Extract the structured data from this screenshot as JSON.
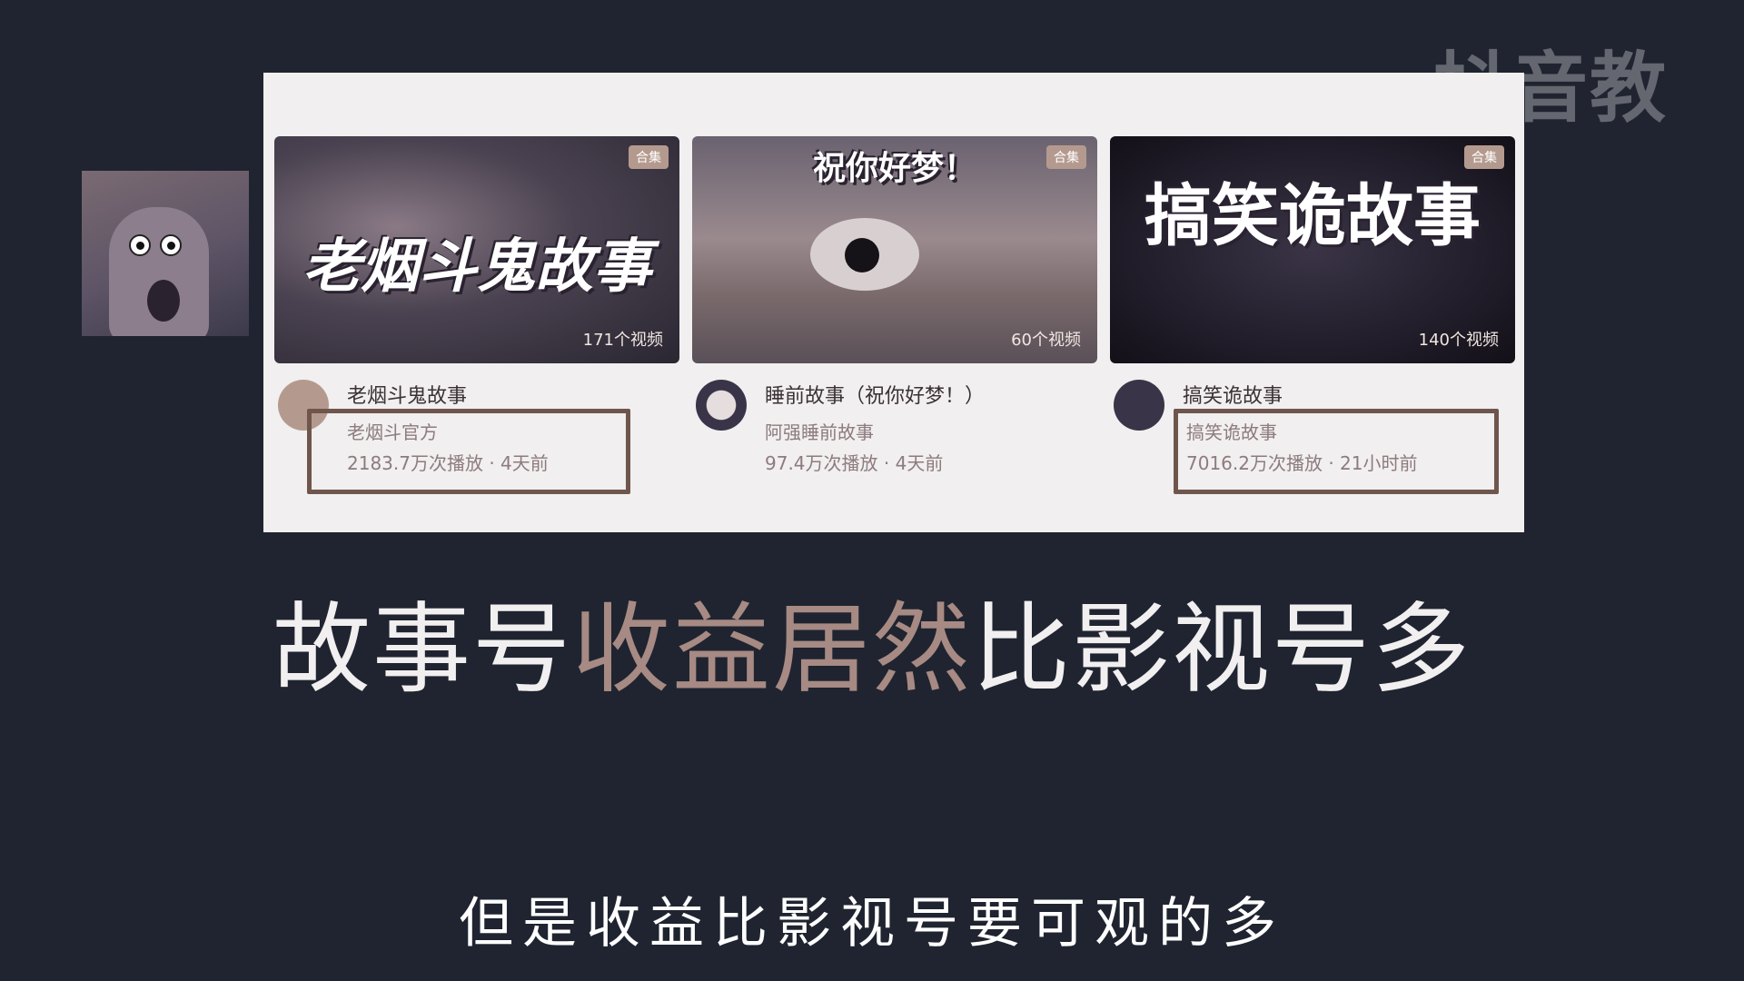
{
  "watermark": "抖音教程",
  "cards": [
    {
      "thumb_title": "老烟斗鬼故事",
      "badge": "合集",
      "video_count": "171个视频",
      "title": "老烟斗鬼故事",
      "author": "老烟斗官方",
      "stats": "2183.7万次播放 · 4天前",
      "highlighted": true
    },
    {
      "thumb_title": "祝你好梦！",
      "badge": "合集",
      "video_count": "60个视频",
      "title": "睡前故事（祝你好梦！）",
      "author": "阿强睡前故事",
      "stats": "97.4万次播放 · 4天前",
      "highlighted": false
    },
    {
      "thumb_title": "搞笑诡故事",
      "badge": "合集",
      "video_count": "140个视频",
      "title": "搞笑诡故事",
      "author": "搞笑诡故事",
      "stats": "7016.2万次播放 · 21小时前",
      "highlighted": true
    }
  ],
  "headline": {
    "part1": "故事号",
    "part2": "收益居然",
    "part3": "比影视号多"
  },
  "subtitle": "但是收益比影视号要可观的多",
  "colors": {
    "background": "#1f2430",
    "accent": "#a68a83",
    "box_border": "#6f564d"
  }
}
